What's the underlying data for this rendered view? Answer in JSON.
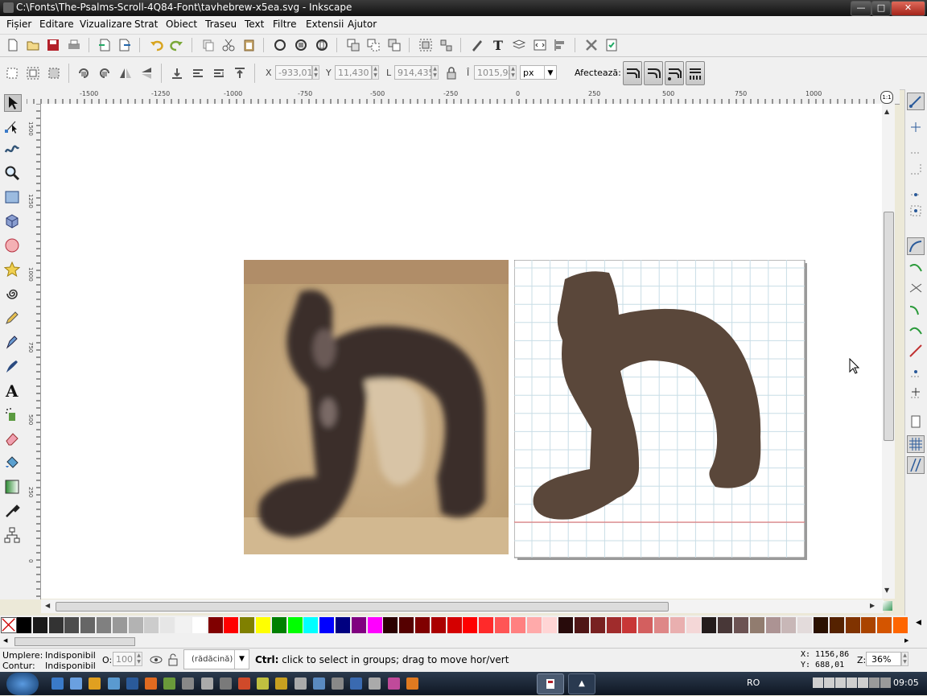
{
  "window": {
    "title": "C:\\Fonts\\The-Psalms-Scroll-4Q84-Font\\tavhebrew-x5ea.svg - Inkscape",
    "controls": [
      "minimize",
      "maximize",
      "close"
    ]
  },
  "menu": {
    "items": [
      "Fișier",
      "Editare",
      "Vizualizare",
      "Strat",
      "Obiect",
      "Traseu",
      "Text",
      "Filtre",
      "Extensii",
      "Ajutor"
    ]
  },
  "selector_toolbar": {
    "x_label": "X",
    "x_value": "-933,01",
    "y_label": "Y",
    "y_value": "11,430",
    "w_label": "L",
    "w_value": "914,435",
    "h_label": "Î",
    "h_value": "1015,98",
    "unit": "px",
    "affects_label": "Afectează:"
  },
  "rulers": {
    "h_ticks": [
      "-1500",
      "-1250",
      "-1000",
      "-750",
      "-500",
      "-250",
      "0",
      "250",
      "500",
      "750",
      "1000"
    ],
    "v_ticks": [
      "1500",
      "1250",
      "1000",
      "750",
      "500",
      "250",
      "0"
    ],
    "corner_icon": "zoom-fit-icon"
  },
  "palette": {
    "none_icon": "no-paint-icon",
    "colors": [
      "#000000",
      "#1a1a1a",
      "#333333",
      "#4d4d4d",
      "#666666",
      "#808080",
      "#999999",
      "#b3b3b3",
      "#cccccc",
      "#e6e6e6",
      "#f2f2f2",
      "#ffffff",
      "#800000",
      "#ff0000",
      "#808000",
      "#ffff00",
      "#008000",
      "#00ff00",
      "#00ffff",
      "#0000ff",
      "#000080",
      "#800080",
      "#ff00ff",
      "#2b0000",
      "#550000",
      "#800000",
      "#aa0000",
      "#d40000",
      "#ff0000",
      "#ff2a2a",
      "#ff5555",
      "#ff8080",
      "#ffaaaa",
      "#ffd5d5",
      "#280b0b",
      "#501616",
      "#782121",
      "#a02c2c",
      "#c83737",
      "#d35f5f",
      "#de8787",
      "#e9afaf",
      "#f4d7d7",
      "#241c1c",
      "#483737",
      "#6c5353",
      "#917c6f",
      "#ac9393",
      "#c8b7b7",
      "#e3dbdb",
      "#2b1100",
      "#552200",
      "#803300",
      "#aa4400",
      "#d45500",
      "#ff6600"
    ]
  },
  "status": {
    "fill_label": "Umplere:",
    "fill_value": "Indisponibil",
    "stroke_label": "Contur:",
    "stroke_value": "Indisponibil",
    "opacity_label": "O:",
    "opacity_value": "100",
    "layer_value": "(rădăcină)",
    "message": "Ctrl: click to select in groups; drag to move hor/vert",
    "cursor_x": "X: 1156,86",
    "cursor_y": "Y:  688,01",
    "zoom_label": "Z:",
    "zoom_value": "36%"
  },
  "taskbar": {
    "language": "RO",
    "clock": "09:05"
  },
  "colors": {
    "glyph_fill": "#5a473a",
    "grid_line": "#c8dde6",
    "baseline": "#e06060"
  }
}
